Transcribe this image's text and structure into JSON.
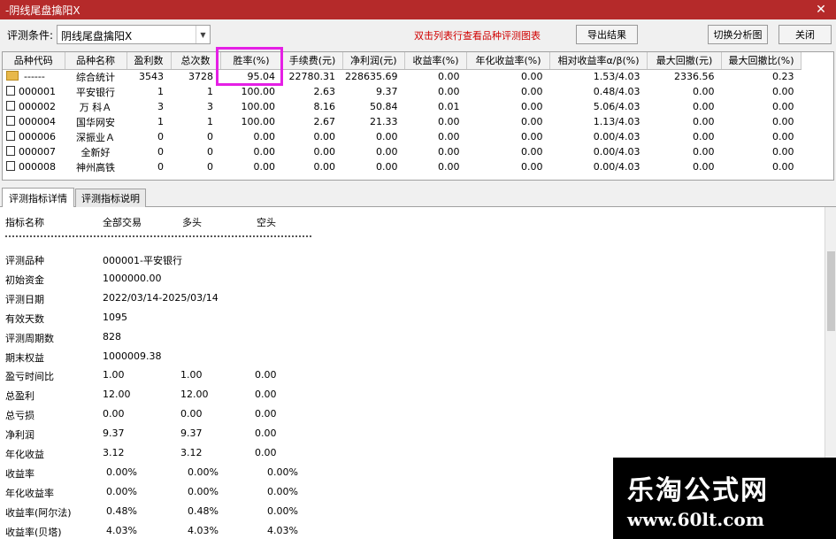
{
  "window": {
    "title": "-阴线尾盘擒阳X",
    "close_glyph": "✕"
  },
  "toolbar": {
    "condition_label": "评测条件:",
    "condition_value": "阴线尾盘擒阳X",
    "hint": "双击列表行查看品种评测图表",
    "export_label": "导出结果",
    "switch_label": "切换分析图",
    "close_label": "关闭"
  },
  "table": {
    "columns": [
      "品种代码",
      "品种名称",
      "盈利数",
      "总次数",
      "胜率(%)",
      "手续费(元)",
      "净利润(元)",
      "收益率(%)",
      "年化收益率(%)",
      "相对收益率α/β(%)",
      "最大回撤(元)",
      "最大回撤比(%)"
    ],
    "rows": [
      [
        "------",
        "综合统计",
        "3543",
        "3728",
        "95.04",
        "22780.31",
        "228635.69",
        "0.00",
        "0.00",
        "1.53/4.03",
        "2336.56",
        "0.23"
      ],
      [
        "000001",
        "平安银行",
        "1",
        "1",
        "100.00",
        "2.63",
        "9.37",
        "0.00",
        "0.00",
        "0.48/4.03",
        "0.00",
        "0.00"
      ],
      [
        "000002",
        "万 科Ａ",
        "3",
        "3",
        "100.00",
        "8.16",
        "50.84",
        "0.01",
        "0.00",
        "5.06/4.03",
        "0.00",
        "0.00"
      ],
      [
        "000004",
        "国华网安",
        "1",
        "1",
        "100.00",
        "2.67",
        "21.33",
        "0.00",
        "0.00",
        "1.13/4.03",
        "0.00",
        "0.00"
      ],
      [
        "000006",
        "深振业Ａ",
        "0",
        "0",
        "0.00",
        "0.00",
        "0.00",
        "0.00",
        "0.00",
        "0.00/4.03",
        "0.00",
        "0.00"
      ],
      [
        "000007",
        "全新好",
        "0",
        "0",
        "0.00",
        "0.00",
        "0.00",
        "0.00",
        "0.00",
        "0.00/4.03",
        "0.00",
        "0.00"
      ],
      [
        "000008",
        "神州高铁",
        "0",
        "0",
        "0.00",
        "0.00",
        "0.00",
        "0.00",
        "0.00",
        "0.00/4.03",
        "0.00",
        "0.00"
      ]
    ]
  },
  "tabs": [
    "评测指标详情",
    "评测指标说明"
  ],
  "detail": {
    "header": [
      "指标名称",
      "全部交易",
      "多头",
      "空头"
    ],
    "separator": "--------------------------------------------------------------------------------",
    "items": [
      [
        "评测品种",
        "000001-平安银行",
        "",
        ""
      ],
      [
        "初始资金",
        "1000000.00",
        "",
        ""
      ],
      [
        "评测日期",
        "2022/03/14-2025/03/14",
        "",
        ""
      ],
      [
        "有效天数",
        "1095",
        "",
        ""
      ],
      [
        "评测周期数",
        "828",
        "",
        ""
      ],
      [
        "期末权益",
        "1000009.38",
        "",
        ""
      ],
      [
        "盈亏时间比",
        "1.00",
        "1.00",
        "0.00"
      ],
      [
        "总盈利",
        "12.00",
        "12.00",
        "0.00"
      ],
      [
        "总亏损",
        "0.00",
        "0.00",
        "0.00"
      ],
      [
        "净利润",
        "9.37",
        "9.37",
        "0.00"
      ],
      [
        "年化收益",
        "3.12",
        "3.12",
        "0.00"
      ],
      [
        "收益率",
        "0.00%",
        "0.00%",
        "0.00%"
      ],
      [
        "年化收益率",
        "0.00%",
        "0.00%",
        "0.00%"
      ],
      [
        "收益率(阿尔法)",
        "0.48%",
        "0.48%",
        "0.00%"
      ],
      [
        "收益率(贝塔)",
        "4.03%",
        "4.03%",
        "4.03%"
      ]
    ]
  },
  "watermark": {
    "line1": "乐淘公式网",
    "line2": "www.60lt.com"
  },
  "colors": {
    "titlebar": "#b52a2a",
    "highlight": "#e51fe5",
    "hint": "#d00000"
  },
  "icons": {
    "summary_row": "folder-icon",
    "stock_row": "document-icon"
  }
}
